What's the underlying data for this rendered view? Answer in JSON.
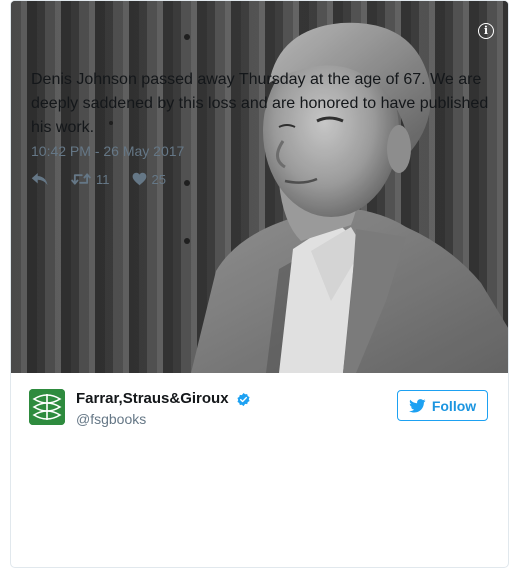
{
  "account": {
    "display_name": "Farrar,Straus&Giroux",
    "handle": "@fsgbooks",
    "verified": true
  },
  "follow_button": {
    "label": "Follow"
  },
  "tweet": {
    "text": "Denis Johnson passed away Thursday at the age of 67. We are deeply saddened by this loss and are honored to have published his work.",
    "timestamp": "10:42 PM - 26 May 2017",
    "retweets": "11",
    "likes": "25"
  },
  "colors": {
    "accent": "#1da1f2",
    "avatar_bg": "#2e8b3e",
    "muted": "#657786"
  },
  "icons": {
    "info": "info-icon",
    "verified": "verified-badge-icon",
    "twitter_bird": "twitter-bird-icon",
    "reply": "reply-icon",
    "retweet": "retweet-icon",
    "like": "heart-icon"
  }
}
